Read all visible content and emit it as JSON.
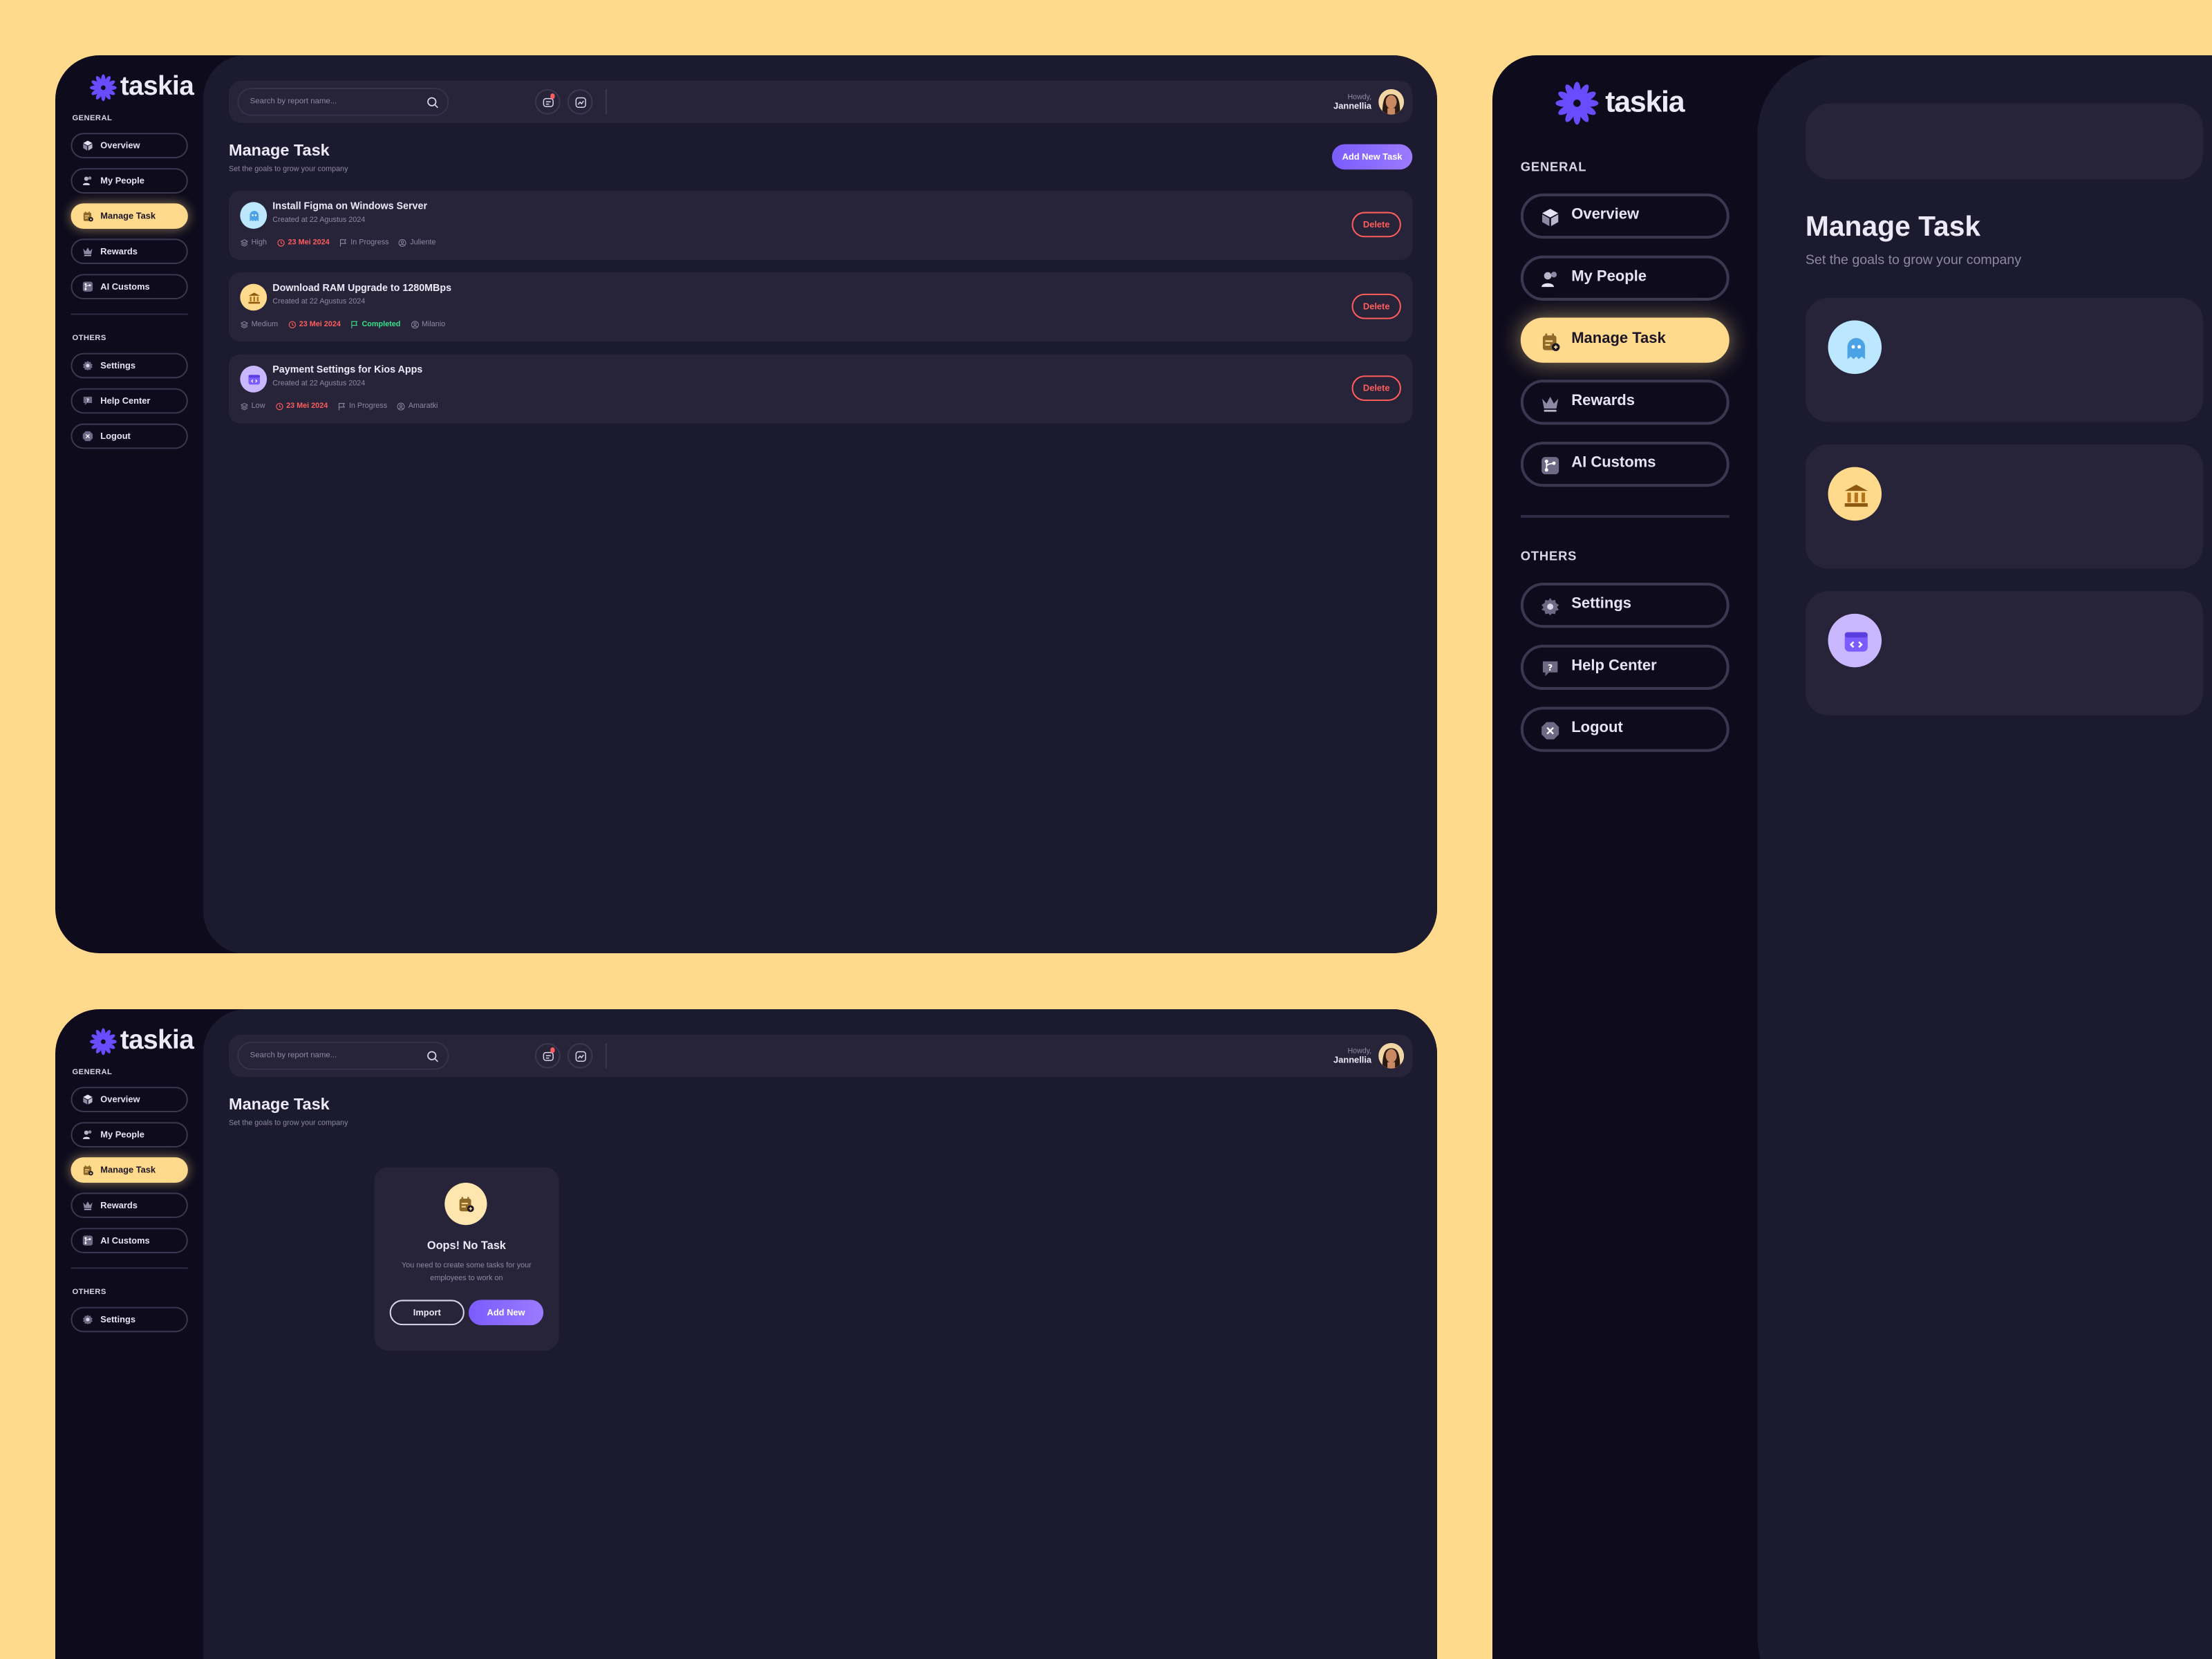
{
  "brand": {
    "name": "taskia",
    "accent": "#7A5CFF",
    "highlight": "#FFD98C",
    "danger": "#FF5C5C",
    "success": "#3BE08A"
  },
  "sidebar": {
    "general_label": "GENERAL",
    "others_label": "OTHERS",
    "general_items": [
      {
        "label": "Overview",
        "icon": "cube-icon"
      },
      {
        "label": "My People",
        "icon": "people-icon"
      },
      {
        "label": "Manage Task",
        "icon": "calendar-task-icon",
        "active": true
      },
      {
        "label": "Rewards",
        "icon": "crown-icon"
      },
      {
        "label": "AI Customs",
        "icon": "branch-icon"
      }
    ],
    "other_items": [
      {
        "label": "Settings",
        "icon": "gear-icon"
      },
      {
        "label": "Help Center",
        "icon": "help-icon"
      },
      {
        "label": "Logout",
        "icon": "logout-icon"
      }
    ]
  },
  "topbar": {
    "search_placeholder": "Search by report name...",
    "greeting": "Howdy,",
    "user_name": "Jannellia"
  },
  "page": {
    "title": "Manage Task",
    "subtitle": "Set the goals to grow your company",
    "add_button": "Add New Task"
  },
  "tasks": [
    {
      "title": "Install Figma on Windows Server",
      "created": "Created at 22 Agustus 2024",
      "priority": "High",
      "due": "23 Mei 2024",
      "status": "In Progress",
      "assignee": "Juliente",
      "icon": "ghost-icon",
      "icon_bg": "#BDE7FF"
    },
    {
      "title": "Download RAM Upgrade to 1280MBps",
      "created": "Created at 22 Agustus 2024",
      "priority": "Medium",
      "due": "23 Mei 2024",
      "status": "Completed",
      "assignee": "Milanio",
      "icon": "bank-icon",
      "icon_bg": "#FFD98C"
    },
    {
      "title": "Payment Settings for Kios Apps",
      "created": "Created at 22 Agustus 2024",
      "priority": "Low",
      "due": "23 Mei 2024",
      "status": "In Progress",
      "assignee": "Amaratki",
      "icon": "code-window-icon",
      "icon_bg": "#C9B8FF"
    }
  ],
  "delete_label": "Delete",
  "empty_state": {
    "title": "Oops! No Task",
    "text": "You need to create some tasks for your employees to work on",
    "import_label": "Import",
    "add_label": "Add New"
  }
}
